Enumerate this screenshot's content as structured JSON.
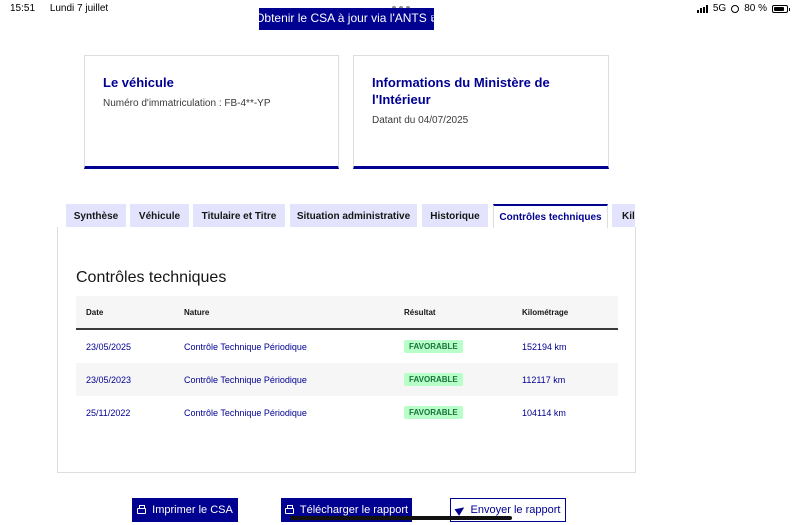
{
  "status_bar": {
    "time": "15:51",
    "date": "Lundi 7 juillet",
    "network": "5G",
    "battery_percent": "80 %",
    "battery_level": 0.8,
    "icons": [
      "signal-icon",
      "orientation-lock-icon",
      "battery-icon"
    ]
  },
  "top_button": {
    "label": "Obtenir le CSA à jour via l'ANTS",
    "icon": "external-link-icon"
  },
  "cards": {
    "vehicle": {
      "title": "Le véhicule",
      "text": "Numéro d'immatriculation : FB-4**-YP"
    },
    "ministry": {
      "title": "Informations du Ministère de l'Intérieur",
      "text": "Datant du 04/07/2025"
    }
  },
  "tabs": [
    {
      "label": "Synthèse"
    },
    {
      "label": "Véhicule"
    },
    {
      "label": "Titulaire et Titre"
    },
    {
      "label": "Situation administrative"
    },
    {
      "label": "Historique"
    },
    {
      "label": "Contrôles techniques",
      "active": true
    },
    {
      "label": "Kilométrage"
    }
  ],
  "panel": {
    "title": "Contrôles techniques",
    "columns": [
      "Date",
      "Nature",
      "Résultat",
      "Kilométrage"
    ],
    "rows": [
      {
        "date": "23/05/2025",
        "nature": "Contrôle Technique Périodique",
        "result": "FAVORABLE",
        "km": "152194 km"
      },
      {
        "date": "23/05/2023",
        "nature": "Contrôle Technique Périodique",
        "result": "FAVORABLE",
        "km": "112117 km"
      },
      {
        "date": "25/11/2022",
        "nature": "Contrôle Technique Périodique",
        "result": "FAVORABLE",
        "km": "104114 km"
      }
    ]
  },
  "actions": {
    "print": {
      "label": "Imprimer le CSA",
      "icon": "printer-icon"
    },
    "download": {
      "label": "Télécharger le rapport",
      "icon": "printer-icon"
    },
    "send": {
      "label": "Envoyer le rapport",
      "icon": "send-icon"
    }
  },
  "colors": {
    "primary": "#000091",
    "tab_inactive": "#e3e3fd",
    "badge_bg": "#b8fec9",
    "badge_text": "#18753c"
  }
}
